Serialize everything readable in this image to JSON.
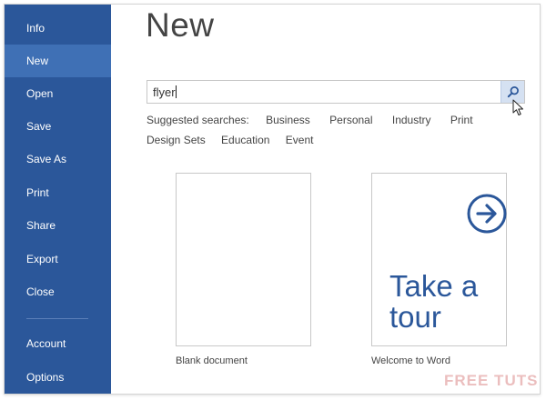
{
  "sidebar": {
    "items": [
      {
        "label": "Info"
      },
      {
        "label": "New",
        "active": true
      },
      {
        "label": "Open"
      },
      {
        "label": "Save"
      },
      {
        "label": "Save As"
      },
      {
        "label": "Print"
      },
      {
        "label": "Share"
      },
      {
        "label": "Export"
      },
      {
        "label": "Close"
      },
      {
        "label": "Account"
      },
      {
        "label": "Options"
      }
    ]
  },
  "main": {
    "title": "New",
    "search": {
      "value": "flyer",
      "button_icon": "search-icon"
    },
    "suggested": {
      "label": "Suggested searches:",
      "row1": [
        "Business",
        "Personal",
        "Industry",
        "Print"
      ],
      "row2": [
        "Design Sets",
        "Education",
        "Event"
      ]
    },
    "templates": [
      {
        "label": "Blank document"
      },
      {
        "label": "Welcome to Word",
        "thumbnail_text": [
          "Take a",
          "tour"
        ],
        "icon": "arrow-right-circle-icon"
      }
    ]
  },
  "watermark": "FREE TUTS",
  "colors": {
    "sidebar": "#2b579a",
    "sidebar_active": "#3f70b5",
    "accent": "#2b579a"
  }
}
